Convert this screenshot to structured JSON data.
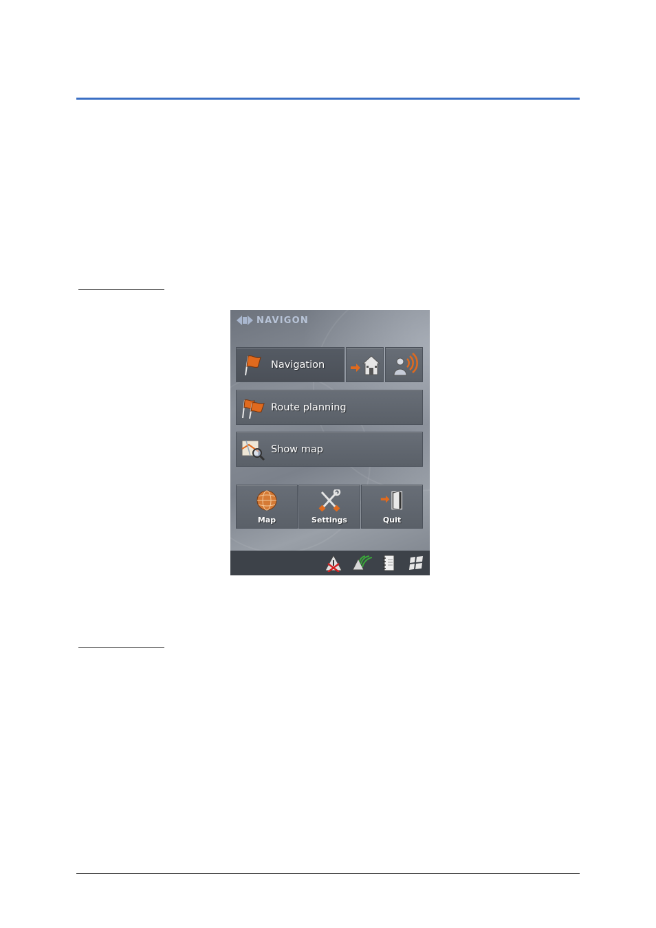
{
  "screen": {
    "brand": "NAVIGON",
    "buttons": {
      "navigation": "Navigation",
      "route_planning": "Route planning",
      "show_map": "Show map",
      "map": "Map",
      "settings": "Settings",
      "quit": "Quit"
    },
    "icons": {
      "navigation": "flag-icon",
      "take_me_home": "home-icon",
      "gps_status": "person-signal-icon",
      "route_planning": "flags-icon",
      "show_map": "map-magnifier-icon",
      "map": "globe-icon",
      "settings": "tools-icon",
      "quit": "exit-door-icon",
      "status_bar": [
        "warning-icon",
        "satellite-icon",
        "notebook-icon",
        "windows-icon"
      ]
    }
  },
  "colors": {
    "rule_blue": "#3a6fc4",
    "accent_orange": "#e06a1e"
  }
}
